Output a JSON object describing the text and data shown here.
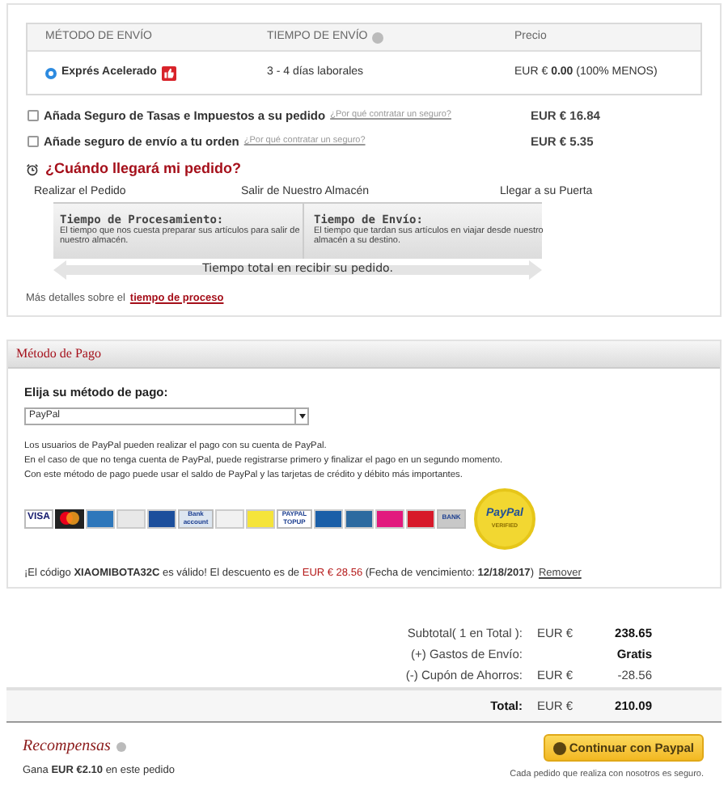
{
  "shipping": {
    "columns": [
      "MÉTODO DE ENVÍO",
      "TIEMPO DE ENVÍO",
      "Precio"
    ],
    "options": [
      {
        "method": "Exprés Acelerado",
        "time": "3 - 4 días laborales",
        "currency": "EUR €",
        "price": "0.00",
        "note": "(100% MENOS)",
        "selected": true
      }
    ]
  },
  "insurance": [
    {
      "label": "Añada Seguro de Tasas e Impuestos a su pedido",
      "link": "¿Por qué contratar un seguro?",
      "price": "EUR € 16.84",
      "checked": false
    },
    {
      "label": "Añade seguro de envío a tu orden",
      "link": "¿Por qué contratar un seguro?",
      "price": "EUR € 5.35",
      "checked": false
    }
  ],
  "delivery": {
    "heading": "¿Cuándo llegará mi pedido?",
    "milestones": [
      "Realizar el Pedido",
      "Salir de Nuestro Almacén",
      "Llegar a su Puerta"
    ],
    "steps": [
      {
        "title": "Tiempo de Procesamiento:",
        "text": "El tiempo que nos cuesta preparar sus artículos para salir de nuestro almacén."
      },
      {
        "title": "Tiempo de Envío:",
        "text": "El tiempo que tardan sus artículos en viajar desde nuestro almacén a su destino."
      }
    ],
    "total_label": "Tiempo total en recibir su pedido.",
    "more_text": "Más detalles sobre el",
    "more_link": "tiempo de proceso"
  },
  "payment": {
    "title": "Método de Pago",
    "select_label": "Elija su método de pago:",
    "select_value": "PayPal",
    "description": [
      "Los usuarios de PayPal pueden realizar el pago con su cuenta de PayPal.",
      "En el caso de que no tenga cuenta de PayPal, puede registrarse primero y finalizar el pago en un segundo momento.",
      "Con este método de pago puede usar el saldo de PayPal y las tarjetas de crédito y débito más importantes."
    ],
    "logos": [
      {
        "kind": "text",
        "label": "VISA",
        "color": "#1a1f71"
      },
      {
        "kind": "mc",
        "color": "#222222"
      },
      {
        "kind": "plain",
        "color": "#2e77bb"
      },
      {
        "kind": "plain",
        "color": "#e8e8e8"
      },
      {
        "kind": "plain",
        "color": "#1d4f9c"
      },
      {
        "kind": "text",
        "label": "Bank account",
        "color": "#dde6f0"
      },
      {
        "kind": "plain",
        "color": "#f1f1f1"
      },
      {
        "kind": "plain",
        "color": "#f5e43a"
      },
      {
        "kind": "text",
        "label": "PAYPAL TOPUP",
        "color": "#ffffff"
      },
      {
        "kind": "plain",
        "color": "#1b5fa8"
      },
      {
        "kind": "plain",
        "color": "#2c6aa0"
      },
      {
        "kind": "plain",
        "color": "#e2197e"
      },
      {
        "kind": "plain",
        "color": "#d7192a"
      },
      {
        "kind": "text",
        "label": "BANK",
        "color": "#c8c8c8"
      }
    ],
    "seal": {
      "label": "PayPal",
      "sub": "VERIFIED"
    },
    "coupon": [
      {
        "kind": "plain",
        "text": "¡El código "
      },
      {
        "kind": "bold",
        "text": "XIAOMIBOTA32C"
      },
      {
        "kind": "plain",
        "text": " es válido! El descuento es de "
      },
      {
        "kind": "red",
        "text": "EUR € 28.56"
      },
      {
        "kind": "plain",
        "text": " (Fecha de vencimiento: "
      },
      {
        "kind": "bold",
        "text": "12/18/2017"
      },
      {
        "kind": "plain",
        "text": ")"
      }
    ],
    "coupon_link": "Remover"
  },
  "totals": [
    {
      "label": "Subtotal( 1 en Total ):",
      "currency": "EUR €",
      "value": "238.65",
      "bold": true
    },
    {
      "label": "(+) Gastos de Envío:",
      "value": "Gratis",
      "bold": true
    },
    {
      "label": "(-) Cupón de Ahorros:",
      "currency": "EUR €",
      "value": "-28.56",
      "bold": false
    }
  ],
  "grand_total": {
    "label": "Total:",
    "currency": "EUR €",
    "value": "210.09"
  },
  "rewards": {
    "title": "Recompensas",
    "text": "Gana **EUR €2.10** en este pedido"
  },
  "checkout": {
    "button": "Continuar con Paypal",
    "note": "Cada pedido que realiza con nosotros es seguro."
  }
}
